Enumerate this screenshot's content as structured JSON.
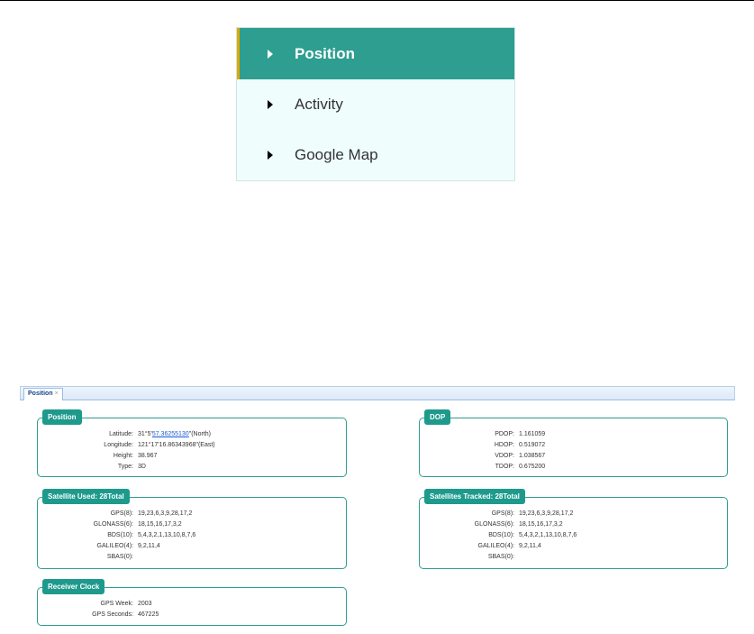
{
  "menu": {
    "items": [
      {
        "label": "Position"
      },
      {
        "label": "Activity"
      },
      {
        "label": "Google Map"
      }
    ]
  },
  "tabs": [
    {
      "label": "Position",
      "close": "×"
    }
  ],
  "position": {
    "title": "Position",
    "latitude_label": "Latitude:",
    "latitude_prefix": "31°5'",
    "latitude_link": "57.36255130",
    "latitude_suffix": "\"(North)",
    "longitude_label": "Longitude:",
    "longitude_value": "121°17'16.86343968\"(East)",
    "height_label": "Height:",
    "height_value": "38.967",
    "type_label": "Type:",
    "type_value": "3D"
  },
  "dop": {
    "title": "DOP",
    "rows": [
      {
        "label": "PDOP:",
        "value": "1.161059"
      },
      {
        "label": "HDOP:",
        "value": "0.519072"
      },
      {
        "label": "VDOP:",
        "value": "1.038567"
      },
      {
        "label": "TDOP:",
        "value": "0.675200"
      }
    ]
  },
  "sat_used": {
    "title": "Satellite Used:  28Total",
    "rows": [
      {
        "label": "GPS(8):",
        "value": "19,23,6,3,9,28,17,2"
      },
      {
        "label": "GLONASS(6):",
        "value": "18,15,16,17,3,2"
      },
      {
        "label": "BDS(10):",
        "value": "5,4,3,2,1,13,10,8,7,6"
      },
      {
        "label": "GALILEO(4):",
        "value": "9,2,11,4"
      },
      {
        "label": "SBAS(0):",
        "value": ""
      }
    ]
  },
  "sat_tracked": {
    "title": "Satellites Tracked:  28Total",
    "rows": [
      {
        "label": "GPS(8):",
        "value": "19,23,6,3,9,28,17,2"
      },
      {
        "label": "GLONASS(6):",
        "value": "18,15,16,17,3,2"
      },
      {
        "label": "BDS(10):",
        "value": "5,4,3,2,1,13,10,8,7,6"
      },
      {
        "label": "GALILEO(4):",
        "value": "9,2,11,4"
      },
      {
        "label": "SBAS(0):",
        "value": ""
      }
    ]
  },
  "clock": {
    "title": "Receiver Clock",
    "week_label": "GPS Week:",
    "week_value": "2003",
    "seconds_label": "GPS Seconds:",
    "seconds_value": "467225"
  }
}
